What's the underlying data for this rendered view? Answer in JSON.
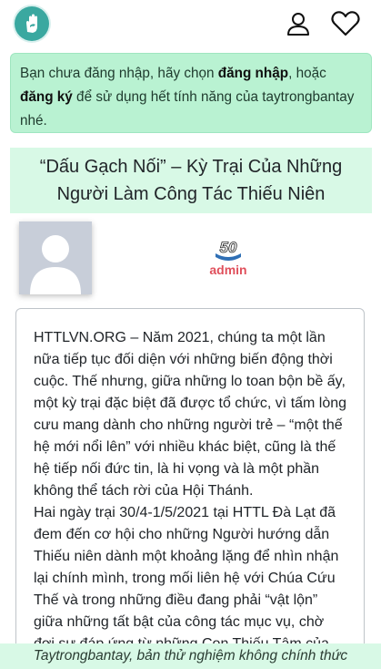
{
  "header": {
    "logo_icon": "hand-dove-logo-icon",
    "user_icon": "user-icon",
    "heart_icon": "heart-icon",
    "accent_color": "#3aa8a0"
  },
  "notice": {
    "part1": "Bạn chưa đăng nhập, hãy chọn ",
    "login": "đăng nhập",
    "part2": ", hoặc ",
    "register": "đăng ký",
    "part3": " để sử dụng hết tính năng của taytrongbantay nhé.",
    "bg_color": "#b9f2d2"
  },
  "article": {
    "title": "“Dấu Gạch Nối” – Kỳ Trại Của Những Người Làm Công Tác Thiếu Niên",
    "author": {
      "name": "admin",
      "badge": "50",
      "name_color": "#e0505c"
    },
    "paragraphs": [
      "HTTLVN.ORG – Năm 2021, chúng ta một lần nữa tiếp tục đối diện với những biến động thời cuộc. Thế nhưng, giữa những lo toan bộn bề ấy, một kỳ trại đặc biệt đã được tổ chức, vì tấm lòng cưu mang dành cho những người trẻ – “một thế hệ mới nổi lên” với nhiều khác biệt, cũng là thế hệ tiếp nối đức tin, là hi vọng và là một phần không thể tách rời của Hội Thánh.",
      "Hai ngày trại 30/4-1/5/2021 tại HTTL Đà Lạt đã đem đến cơ hội cho những Người hướng dẫn Thiếu niên dành một khoảng lặng để nhìn nhận lại chính mình, trong mối liên hệ với Chúa Cứu Thế và trong những điều đang phải “vật lộn” giữa những tất bật của công tác mục vụ, chờ đợi sự đáp ứng từ những Con Thiếu Tâm của"
    ]
  },
  "footer": {
    "text": "Taytrongbantay, bản thử nghiệm không chính thức"
  }
}
